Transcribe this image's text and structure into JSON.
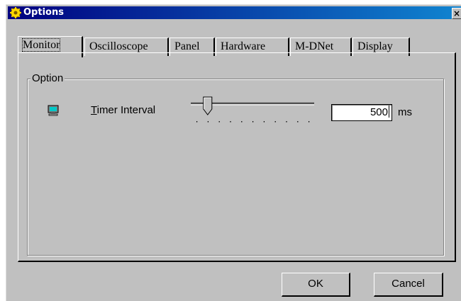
{
  "window": {
    "title": "Options",
    "close_glyph": "×"
  },
  "tabs": [
    {
      "label": "Monitor",
      "active": true
    },
    {
      "label": "Oscilloscope",
      "active": false
    },
    {
      "label": "Panel",
      "active": false
    },
    {
      "label": "Hardware",
      "active": false
    },
    {
      "label": "M-DNet",
      "active": false
    },
    {
      "label": "Display",
      "active": false
    }
  ],
  "option_group": {
    "label": "Option",
    "icon": "monitor-icon",
    "timer": {
      "label_first_letter": "T",
      "label_rest": "imer Interval",
      "slider_position": 0.1,
      "value": "500",
      "units": "ms"
    }
  },
  "buttons": {
    "ok": "OK",
    "cancel": "Cancel"
  },
  "colors": {
    "face": "#c0c0c0",
    "title_start": "#000080",
    "title_end": "#1084d0"
  }
}
